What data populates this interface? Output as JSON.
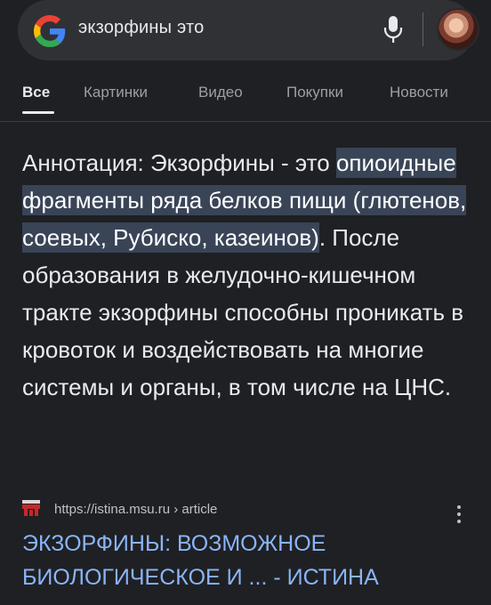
{
  "search": {
    "query": "экзорфины это"
  },
  "tabs": [
    {
      "label": "Все",
      "active": true
    },
    {
      "label": "Картинки"
    },
    {
      "label": "Видео"
    },
    {
      "label": "Покупки"
    },
    {
      "label": "Новости"
    }
  ],
  "snippet": {
    "prefix": "Аннотация: Экзорфины - это ",
    "highlight": "опиоидные фрагменты ряда белков пищи (глютенов, соевых, Рубиско, казеинов)",
    "suffix": ". После образования в желудочно-кишечном тракте экзорфины способны проникать в кровоток и воздействовать на многие системы и органы, в том числе на ЦНС."
  },
  "result": {
    "url": "https://istina.msu.ru › article",
    "title": "ЭКЗОРФИНЫ: ВОЗМОЖНОЕ БИОЛОГИЧЕСКОЕ И ... - ИСТИНА"
  },
  "colors": {
    "background": "#1f2023",
    "searchbar": "#303134",
    "highlight": "#394457",
    "link": "#8ab4f8"
  },
  "icons": {
    "logo": "google-g-icon",
    "mic": "microphone-icon",
    "favicon": "istina-favicon-icon",
    "menu": "more-vert-icon"
  }
}
